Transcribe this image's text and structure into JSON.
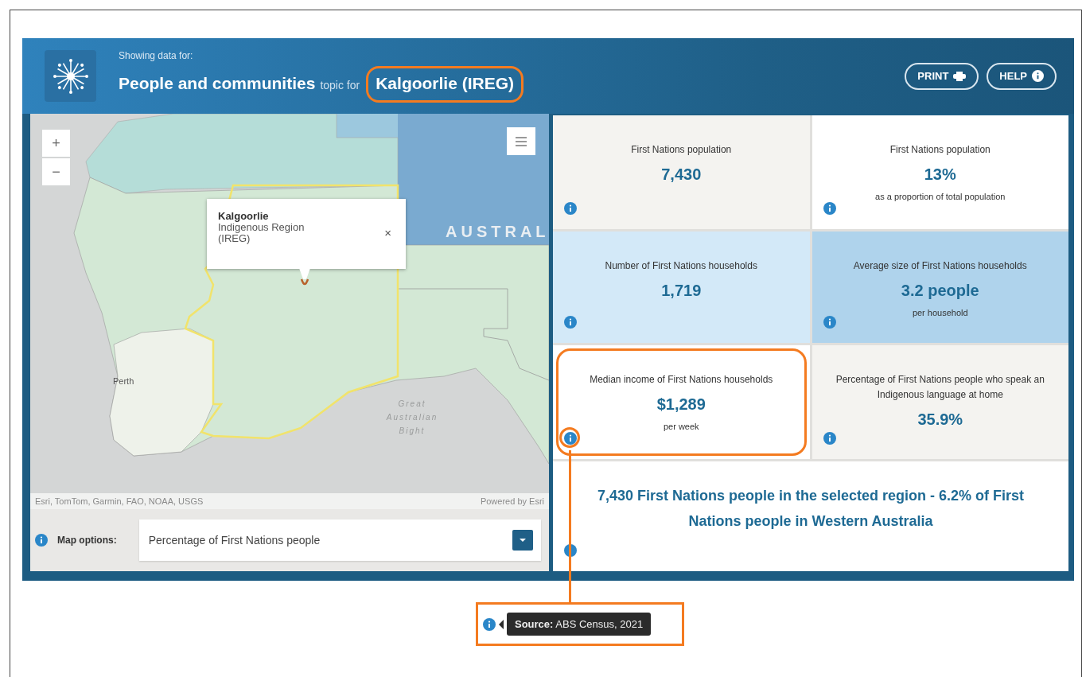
{
  "header": {
    "eyebrow": "Showing data for:",
    "topic": "People and communities",
    "connector": "topic for",
    "region": "Kalgoorlie (IREG)",
    "region_highlighted": true,
    "buttons": [
      {
        "label": "PRINT",
        "kind": "print"
      },
      {
        "label": "HELP",
        "kind": "help"
      }
    ]
  },
  "map": {
    "zoom_in": "+",
    "zoom_out": "−",
    "labels": [
      {
        "kind": "country",
        "text": "AUSTRAL"
      },
      {
        "kind": "city",
        "text": "Perth"
      },
      {
        "kind": "water",
        "text": "Great Australian Bight"
      }
    ],
    "popup": {
      "title": "Kalgoorlie",
      "subtitle": "Indigenous Region (IREG)",
      "close": "×"
    },
    "attribution": "Esri, TomTom, Garmin, FAO, NOAA, USGS",
    "powered_by": "Powered by Esri"
  },
  "map_options": {
    "label": "Map options:",
    "value": "Percentage of First Nations people"
  },
  "tiles": [
    {
      "label": "First Nations population",
      "value": "7,430",
      "color": "#f4f3f0",
      "highlighted": false
    },
    {
      "label": "First Nations population",
      "value": "13%",
      "note": "as a proportion of total population",
      "color": "#ffffff",
      "highlighted": false
    },
    {
      "label": "Number of First Nations households",
      "value": "1,719",
      "color": "#d3e9f8",
      "highlighted": false
    },
    {
      "label": "Average size of First Nations households",
      "value": "3.2 people",
      "note": "per household",
      "color": "#afd3ec",
      "highlighted": false
    },
    {
      "label": "Median income of First Nations households",
      "value": "$1,289",
      "note": "per week",
      "color": "#ffffff",
      "highlighted": true
    },
    {
      "label": "Percentage of First Nations people who speak an Indigenous language at home",
      "value": "35.9%",
      "color": "#f4f3f0",
      "highlighted": false
    }
  ],
  "summary": "7,430 First Nations people in the selected region - 6.2% of First Nations people in Western Australia",
  "source_tooltip": "**Source:** ABS Census, 2021"
}
